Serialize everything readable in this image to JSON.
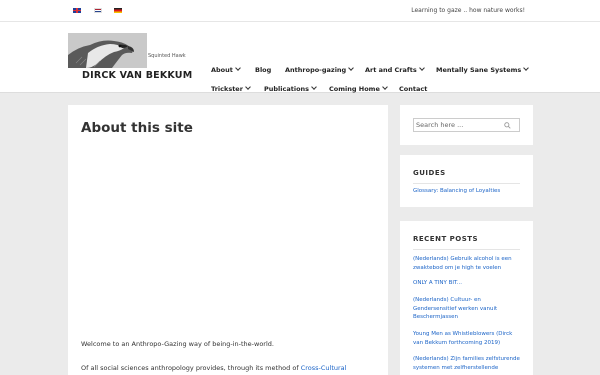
{
  "topbar": {
    "languages": [
      {
        "name": "English",
        "icon": "uk-flag-icon"
      },
      {
        "name": "Nederlands",
        "icon": "nl-flag-icon"
      },
      {
        "name": "Deutsch",
        "icon": "de-flag-icon"
      }
    ],
    "tagline": "Learning to gaze .. how nature works!"
  },
  "header": {
    "logo_caption": "Squinted Hawk",
    "site_name": "DIRCK VAN BEKKUM"
  },
  "nav": [
    {
      "label": "About",
      "has_dropdown": true
    },
    {
      "label": "Blog",
      "has_dropdown": false
    },
    {
      "label": "Anthropo-gazing",
      "has_dropdown": true
    },
    {
      "label": "Art and Crafts",
      "has_dropdown": true
    },
    {
      "label": "Mentally Sane Systems",
      "has_dropdown": true
    },
    {
      "label": "Trickster",
      "has_dropdown": true
    },
    {
      "label": "Publications",
      "has_dropdown": true
    },
    {
      "label": "Coming Home",
      "has_dropdown": true
    },
    {
      "label": "Contact",
      "has_dropdown": false
    }
  ],
  "main": {
    "title": "About this site",
    "paragraph1": "Welcome to an Anthropo-Gazing way of being-in-the-world.",
    "paragraph2_text": "Of all social sciences anthropology provides, through its method of ",
    "paragraph2_link": "Cross-Cultural"
  },
  "sidebar": {
    "search_placeholder": "Search here ...",
    "guides_heading": "GUIDES",
    "guides": [
      "Glossary: Balancing of Loyalties"
    ],
    "recent_heading": "RECENT POSTS",
    "recent_posts": [
      [
        "(Nederlands) Gebruik alcohol is een",
        "zwaktebod om je high te voelen"
      ],
      [
        "ONLY A TINY BIT..."
      ],
      [
        "(Nederlands) Cultuur- en",
        "Gendersensitief werken vanuit",
        "Beschermjassen"
      ],
      [
        "Young Men as Whistleblowers (Dirck",
        "van Bekkum forthcoming 2019)"
      ],
      [
        "(Nederlands) Zijn families zelfsturende",
        "systemen met zelfherstellende"
      ]
    ]
  },
  "colors": {
    "link": "#1a63c7",
    "background": "#ebebeb",
    "text": "#333333"
  }
}
